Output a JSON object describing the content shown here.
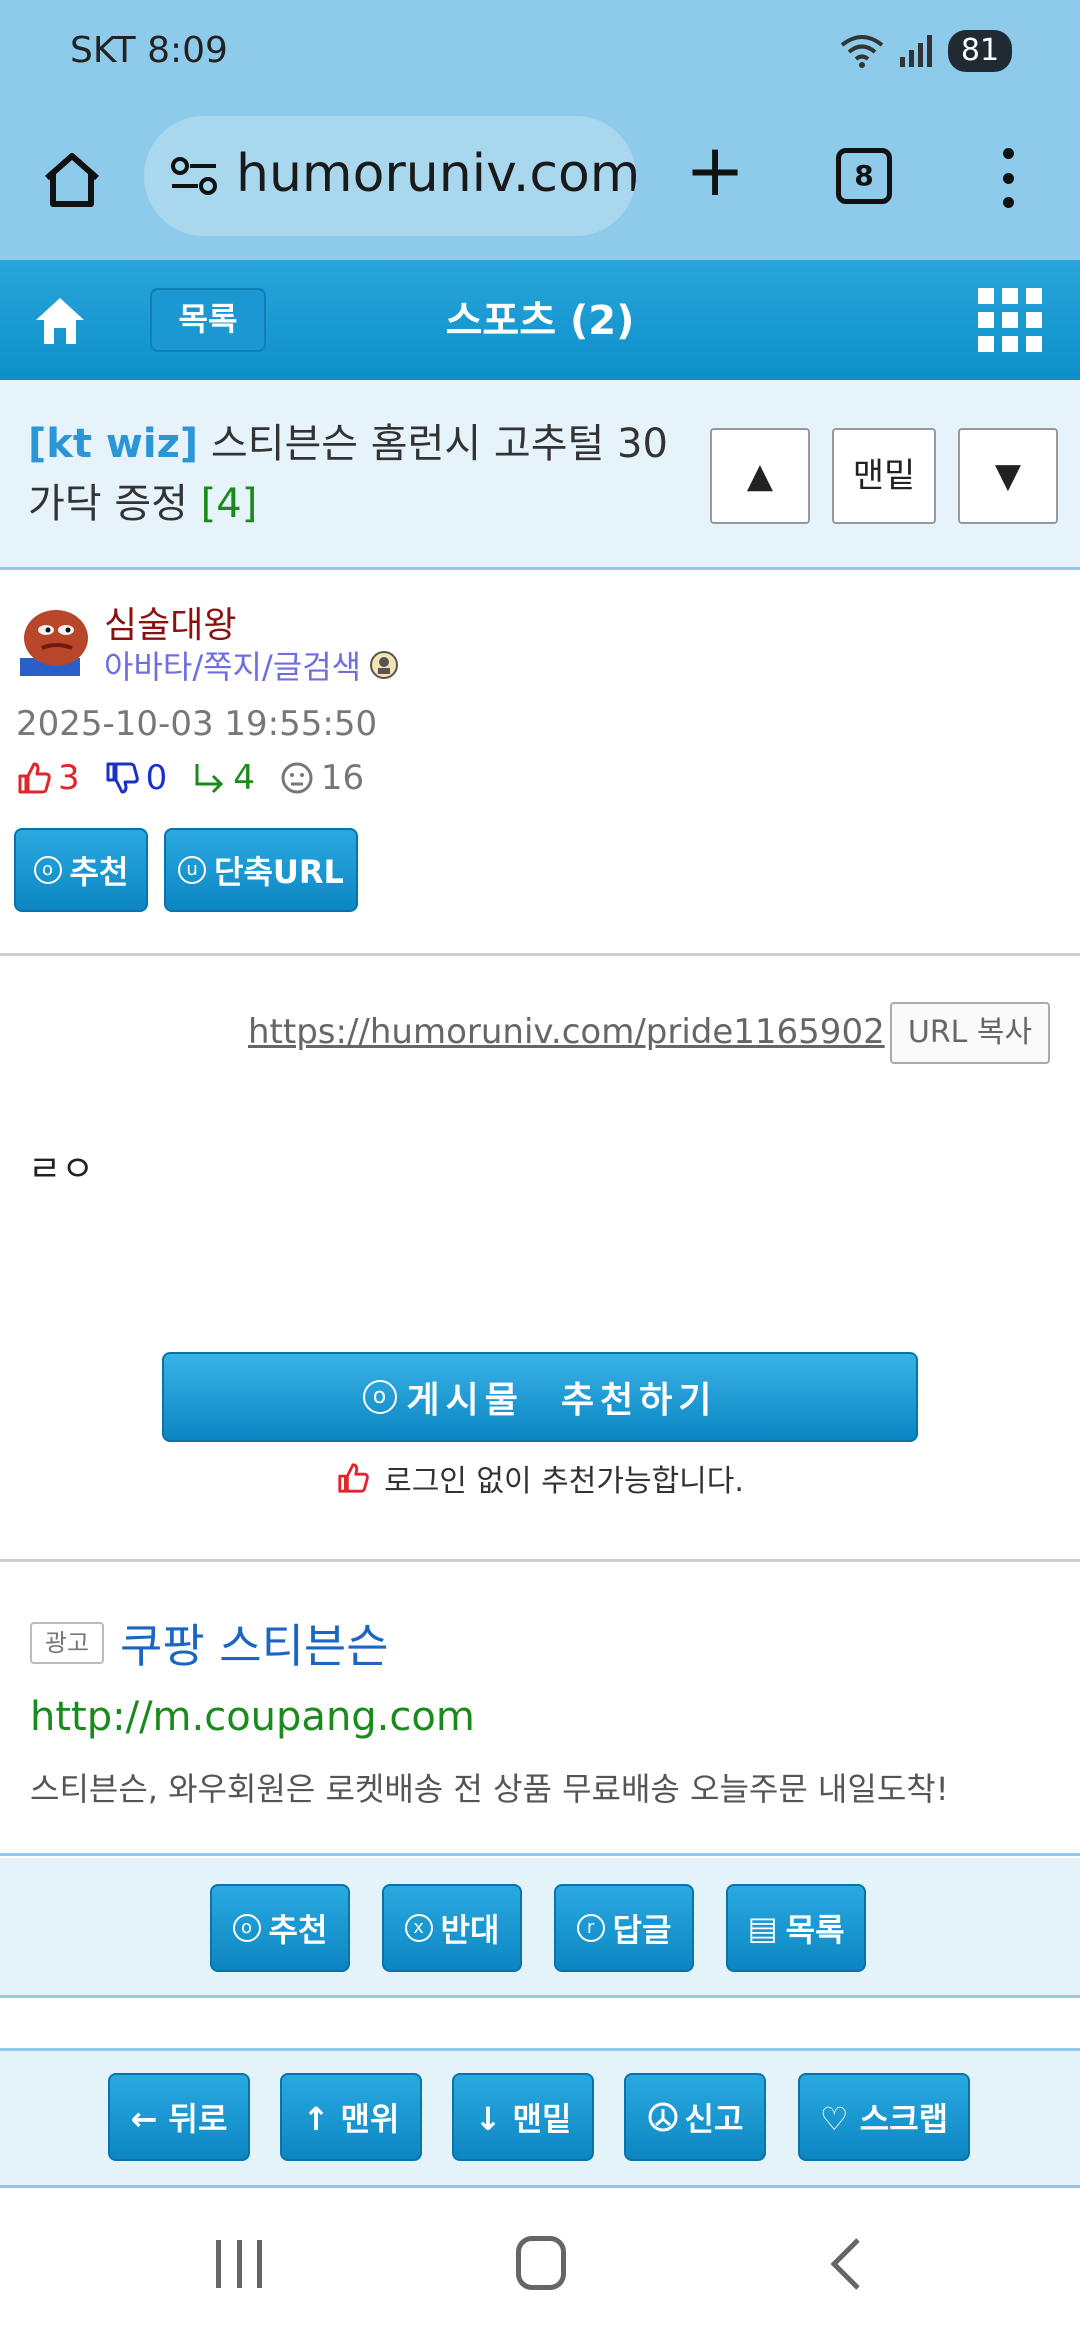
{
  "status_bar": {
    "carrier": "SKT",
    "time": "8:09",
    "battery": "81"
  },
  "browser": {
    "url": "humoruniv.com",
    "tab_count": "8"
  },
  "site_nav": {
    "list_label": "목록",
    "board_title": "스포츠 (2)"
  },
  "post_header": {
    "category": "[kt wiz]",
    "title": " 스티븐슨 홈런시 고추털 30 가닥 증정 ",
    "comment_count": "[4]",
    "up_symbol": "▲",
    "bottom_label": "맨밑",
    "down_symbol": "▼"
  },
  "author": {
    "name": "심술대왕",
    "links": "아바타/쪽지/글검색",
    "date": "2025-10-03 19:55:50",
    "stats": {
      "likes": "3",
      "dislikes": "0",
      "replies": "4",
      "views": "16"
    },
    "buttons": {
      "recommend": "추천",
      "recommend_key": "o",
      "short_url": "단축URL",
      "short_url_key": "u"
    }
  },
  "content": {
    "permalink": "https://humoruniv.com/pride1165902",
    "url_copy_label": "URL 복사",
    "body": "ㄹㅇ",
    "recommend_post_label": "게시물  추천하기",
    "recommend_key": "o",
    "login_note": "로그인 없이 추천가능합니다."
  },
  "ad": {
    "badge": "광고",
    "title": "쿠팡 스티븐슨",
    "url": "http://m.coupang.com",
    "description": "스티븐슨, 와우회원은 로켓배송 전 상품 무료배송 오늘주문 내일도착!"
  },
  "actions": [
    {
      "key": "o",
      "label": "추천"
    },
    {
      "key": "x",
      "label": "반대"
    },
    {
      "key": "r",
      "label": "답글"
    },
    {
      "key": "▤",
      "label": "목록"
    }
  ],
  "bottom_nav": [
    {
      "label": "← 뒤로"
    },
    {
      "label": "↑ 맨위"
    },
    {
      "label": "↓ 맨밑"
    },
    {
      "label": "신고"
    },
    {
      "label": "♡ 스크랩"
    }
  ],
  "colors": {
    "accent_blue": "#0c86c2",
    "header_bg": "#8ecbea",
    "author_name": "#8b1010",
    "ad_link": "#1a8a1a"
  }
}
